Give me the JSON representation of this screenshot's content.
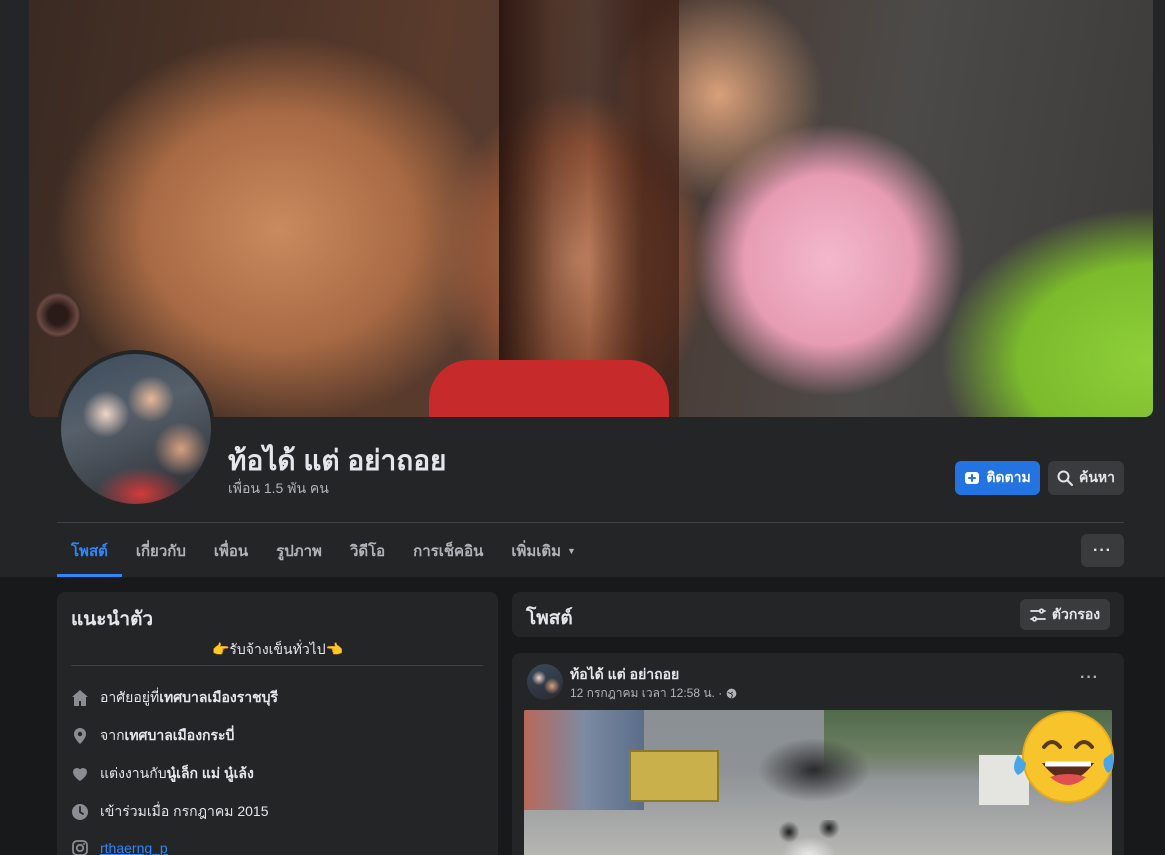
{
  "profile": {
    "name": "ท้อได้ แต่ อย่าถอย",
    "friends": "เพื่อน 1.5 พัน คน",
    "follow_label": "ติดตาม",
    "search_label": "ค้นหา"
  },
  "tabs": [
    {
      "label": "โพสต์"
    },
    {
      "label": "เกี่ยวกับ"
    },
    {
      "label": "เพื่อน"
    },
    {
      "label": "รูปภาพ"
    },
    {
      "label": "วิดีโอ"
    },
    {
      "label": "การเช็คอิน"
    },
    {
      "label": "เพิ่มเติม"
    }
  ],
  "more_label": "···",
  "intro": {
    "title": "แนะนำตัว",
    "bio": "👉รับจ้างเข็นทั่วไป👈",
    "items": [
      {
        "icon": "home-icon",
        "prefix": "อาศัยอยู่ที่ ",
        "value": "เทศบาลเมืองราชบุรี"
      },
      {
        "icon": "location-pin-icon",
        "prefix": "จาก ",
        "value": "เทศบาลเมืองกระบี่"
      },
      {
        "icon": "heart-icon",
        "prefix": "แต่งงานกับ ",
        "value": "นู๋เล็ก แม่ นู๋เล้ง"
      },
      {
        "icon": "clock-icon",
        "prefix": "เข้าร่วมเมื่อ กรกฎาคม 2015",
        "value": ""
      },
      {
        "icon": "instagram-icon",
        "prefix": "",
        "value": "rthaerng_p"
      }
    ]
  },
  "posts": {
    "title": "โพสต์",
    "filter_label": "ตัวกรอง",
    "post": {
      "author": "ท้อได้ แต่ อย่าถอย",
      "meta": "12 กรกฎาคม เวลา 12:58 น. ·",
      "menu": "···"
    }
  },
  "colors": {
    "accent": "#2374e1",
    "active_tab": "#2d88ff",
    "card": "#242526",
    "page": "#18191a"
  }
}
